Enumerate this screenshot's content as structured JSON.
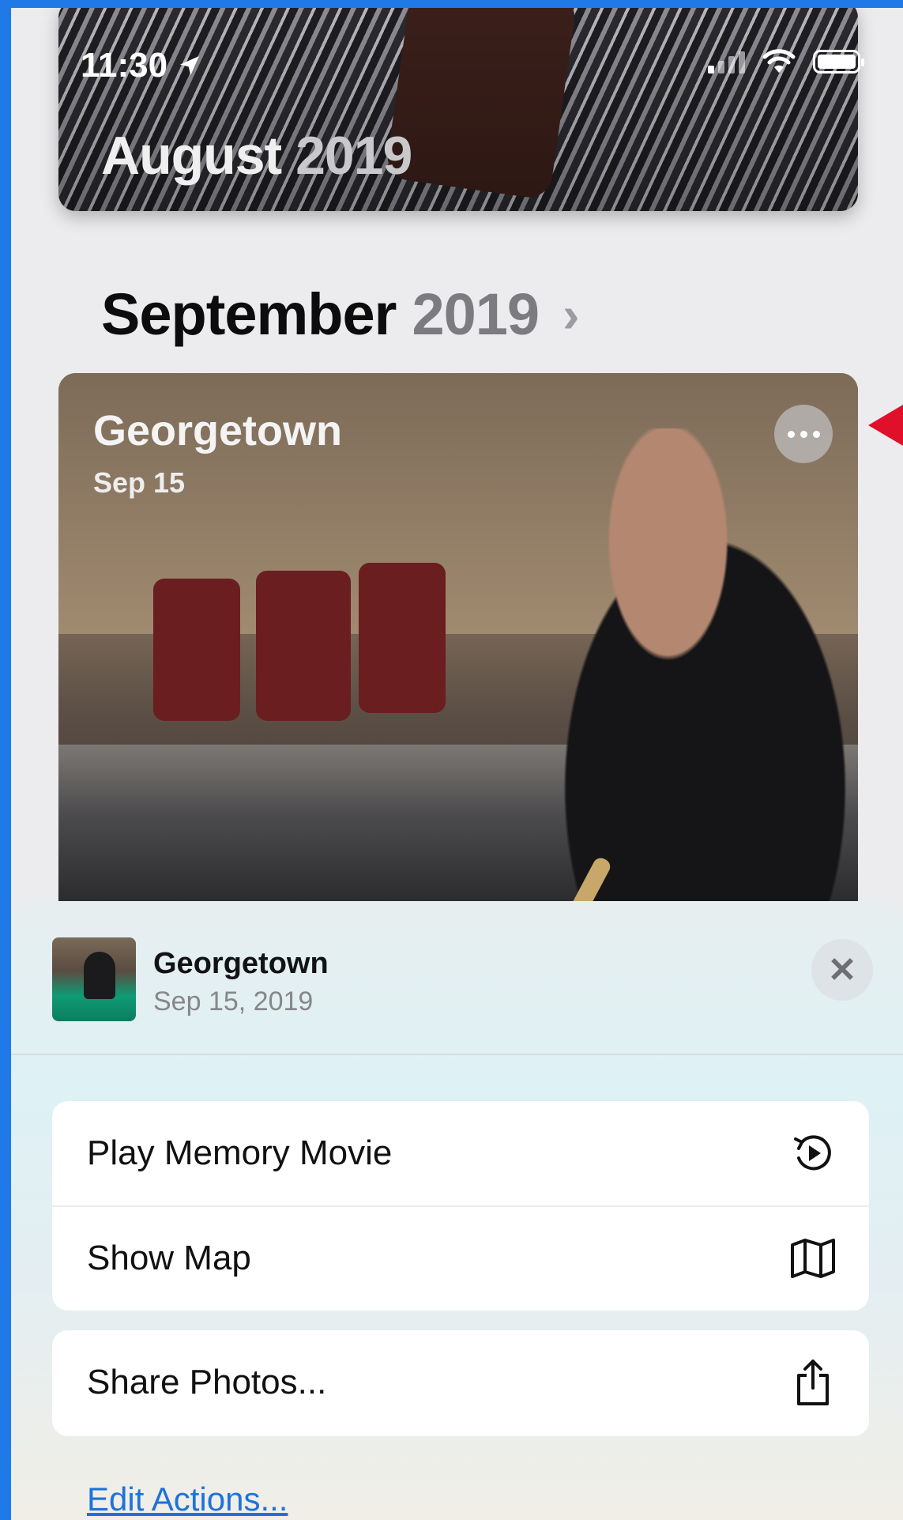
{
  "status_bar": {
    "time": "11:30"
  },
  "previous_month": {
    "month": "August",
    "year": "2019"
  },
  "current_month": {
    "month": "September",
    "year": "2019"
  },
  "memory_card": {
    "title": "Georgetown",
    "date": "Sep 15"
  },
  "sheet": {
    "title": "Georgetown",
    "date": "Sep 15, 2019",
    "actions": [
      {
        "label": "Play Memory Movie",
        "icon": "play-memory-icon"
      },
      {
        "label": "Show Map",
        "icon": "map-icon"
      }
    ],
    "share": {
      "label": "Share Photos...",
      "icon": "share-icon"
    },
    "edit_actions": "Edit Actions..."
  },
  "colors": {
    "frame_blue": "#1f79e6",
    "annotation_arrow": "#e0102a",
    "link_blue": "#1d73d9"
  }
}
